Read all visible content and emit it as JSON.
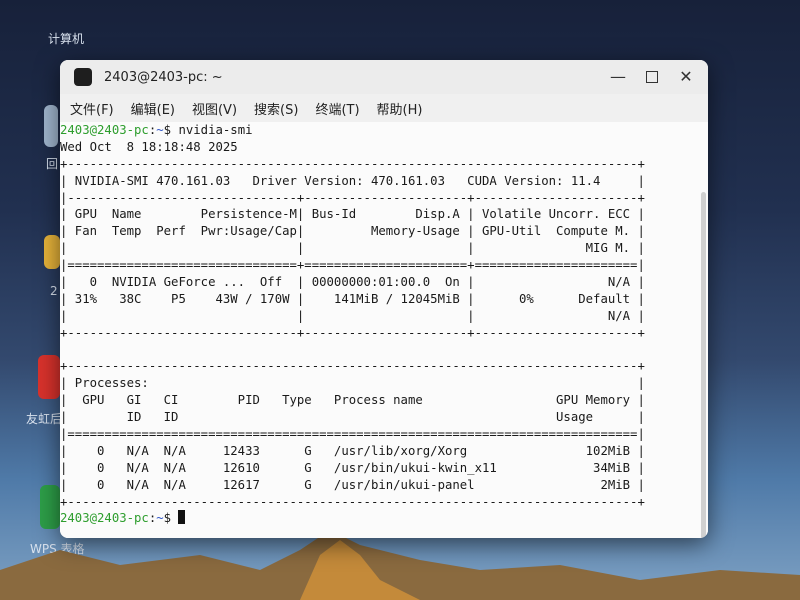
{
  "desktop": {
    "labels": [
      "计算机",
      "回",
      "2",
      "友虹后",
      "WPS 表格"
    ]
  },
  "window": {
    "title": "2403@2403-pc: ~",
    "menu": [
      "文件(F)",
      "编辑(E)",
      "视图(V)",
      "搜索(S)",
      "终端(T)",
      "帮助(H)"
    ]
  },
  "terminal": {
    "prompt_user": "2403@2403-pc",
    "prompt_path": "~",
    "command": "nvidia-smi",
    "lines": [
      "Wed Oct  8 18:18:48 2025",
      "+-----------------------------------------------------------------------------+",
      "| NVIDIA-SMI 470.161.03   Driver Version: 470.161.03   CUDA Version: 11.4     |",
      "|-------------------------------+----------------------+----------------------+",
      "| GPU  Name        Persistence-M| Bus-Id        Disp.A | Volatile Uncorr. ECC |",
      "| Fan  Temp  Perf  Pwr:Usage/Cap|         Memory-Usage | GPU-Util  Compute M. |",
      "|                               |                      |               MIG M. |",
      "|===============================+======================+======================|",
      "|   0  NVIDIA GeForce ...  Off  | 00000000:01:00.0  On |                  N/A |",
      "| 31%   38C    P5    43W / 170W |    141MiB / 12045MiB |      0%      Default |",
      "|                               |                      |                  N/A |",
      "+-------------------------------+----------------------+----------------------+",
      "",
      "+-----------------------------------------------------------------------------+",
      "| Processes:                                                                  |",
      "|  GPU   GI   CI        PID   Type   Process name                  GPU Memory |",
      "|        ID   ID                                                   Usage      |",
      "|=============================================================================|",
      "|    0   N/A  N/A     12433      G   /usr/lib/xorg/Xorg                102MiB |",
      "|    0   N/A  N/A     12610      G   /usr/bin/ukui-kwin_x11             34MiB |",
      "|    0   N/A  N/A     12617      G   /usr/bin/ukui-panel                 2MiB |",
      "+-----------------------------------------------------------------------------+"
    ]
  },
  "colors": {
    "prompt_user": "#2e9e2e",
    "prompt_path": "#2f55c8",
    "terminal_bg": "#fbfbfb"
  }
}
